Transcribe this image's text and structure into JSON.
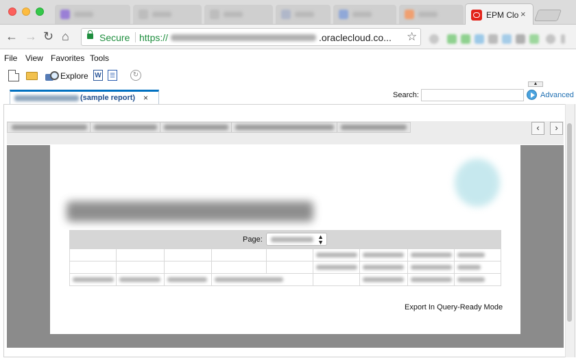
{
  "browser": {
    "active_tab_title": "EPM Clo",
    "tab_close": "×",
    "secure_label": "Secure",
    "url_protocol": "https://",
    "url_host": ".oraclecloud.co..."
  },
  "menu": {
    "file": "File",
    "view": "View",
    "favorites": "Favorites",
    "tools": "Tools"
  },
  "toolbar": {
    "explore_label": "Explore"
  },
  "document_tab": {
    "label": "(sample report)",
    "close": "×"
  },
  "search": {
    "label": "Search:",
    "value": "",
    "advanced_label": "Advanced"
  },
  "report": {
    "page_label": "Page:",
    "export_label": "Export In Query-Ready Mode"
  },
  "colors": {
    "accent": "#0070c0",
    "secure_green": "#1e8e3e",
    "oracle_red": "#e2231a",
    "viewer_gray": "#8b8b8b"
  },
  "icons": [
    "new-document-icon",
    "open-folder-icon",
    "explore-icon",
    "word-export-icon",
    "pdf-export-icon",
    "refresh-icon",
    "advanced-search-icon",
    "star-icon",
    "lock-icon"
  ]
}
